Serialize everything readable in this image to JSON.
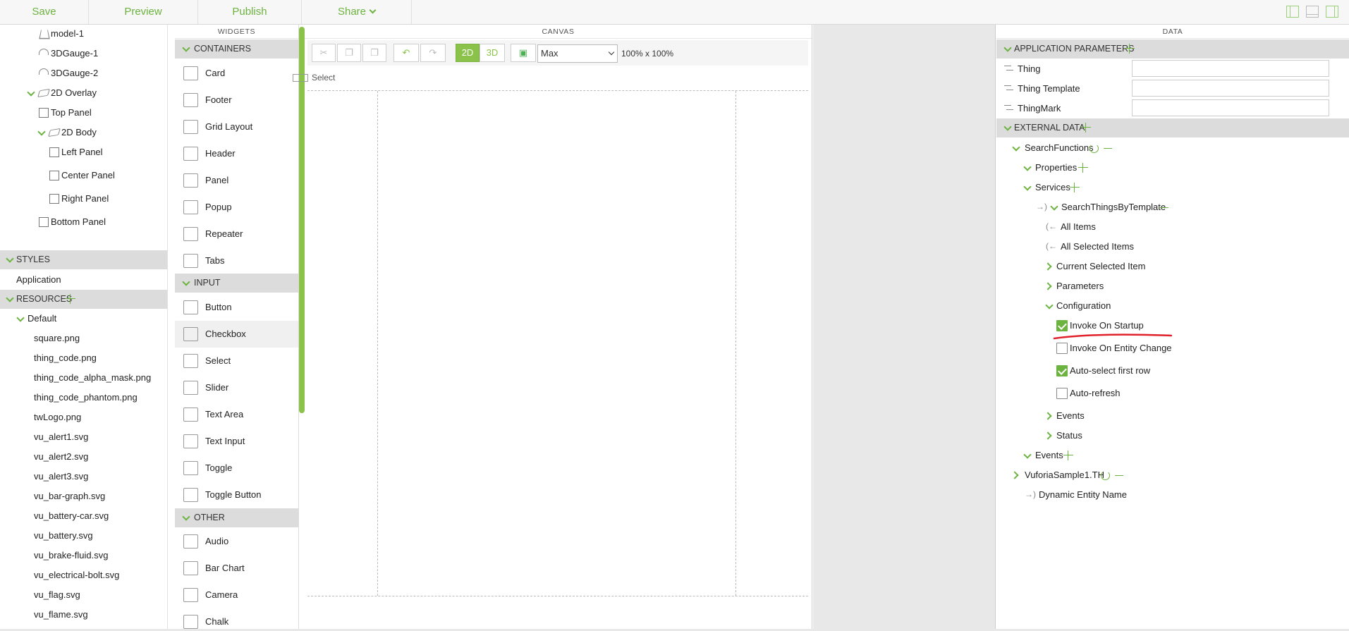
{
  "toolbar": {
    "save": "Save",
    "preview": "Preview",
    "publish": "Publish",
    "share": "Share"
  },
  "tree": {
    "items": [
      "model-1",
      "3DGauge-1",
      "3DGauge-2",
      "2D Overlay",
      "Top Panel",
      "2D Body",
      "Left Panel",
      "Center Panel",
      "Right Panel",
      "Bottom Panel"
    ],
    "styles_header": "STYLES",
    "styles_items": [
      "Application"
    ],
    "resources_header": "RESOURCES",
    "resources_folder": "Default",
    "resources_files": [
      "square.png",
      "thing_code.png",
      "thing_code_alpha_mask.png",
      "thing_code_phantom.png",
      "twLogo.png",
      "vu_alert1.svg",
      "vu_alert2.svg",
      "vu_alert3.svg",
      "vu_bar-graph.svg",
      "vu_battery-car.svg",
      "vu_battery.svg",
      "vu_brake-fluid.svg",
      "vu_electrical-bolt.svg",
      "vu_flag.svg",
      "vu_flame.svg"
    ]
  },
  "widgets": {
    "title": "WIDGETS",
    "containers_header": "CONTAINERS",
    "containers": [
      "Card",
      "Footer",
      "Grid Layout",
      "Header",
      "Panel",
      "Popup",
      "Repeater",
      "Tabs"
    ],
    "input_header": "INPUT",
    "input": [
      "Button",
      "Checkbox",
      "Select",
      "Slider",
      "Text Area",
      "Text Input",
      "Toggle",
      "Toggle Button"
    ],
    "other_header": "OTHER",
    "other": [
      "Audio",
      "Bar Chart",
      "Camera",
      "Chalk"
    ]
  },
  "canvas": {
    "title": "CANVAS",
    "mode_2d": "2D",
    "mode_3d": "3D",
    "size_select": "Max",
    "size_label": "100% x 100%",
    "select_label": "Select"
  },
  "data": {
    "title": "DATA",
    "app_params_header": "APPLICATION PARAMETERS",
    "app_params": [
      "Thing",
      "Thing Template",
      "ThingMark"
    ],
    "external_header": "EXTERNAL DATA",
    "search_functions": "SearchFunctions",
    "properties": "Properties",
    "services": "Services",
    "service_name": "SearchThingsByTemplate",
    "all_items": "All Items",
    "all_selected_items": "All Selected Items",
    "current_selected_item": "Current Selected Item",
    "parameters": "Parameters",
    "configuration": "Configuration",
    "invoke_on_startup": "Invoke On Startup",
    "invoke_on_entity_change": "Invoke On Entity Change",
    "auto_select_first_row": "Auto-select first row",
    "auto_refresh": "Auto-refresh",
    "events_inner": "Events",
    "status": "Status",
    "events_outer": "Events",
    "vuforia": "VuforiaSample1.TH",
    "dynamic_entity": "Dynamic Entity Name"
  },
  "colors": {
    "accent": "#6cb33f",
    "annotation": "#e0202a"
  }
}
